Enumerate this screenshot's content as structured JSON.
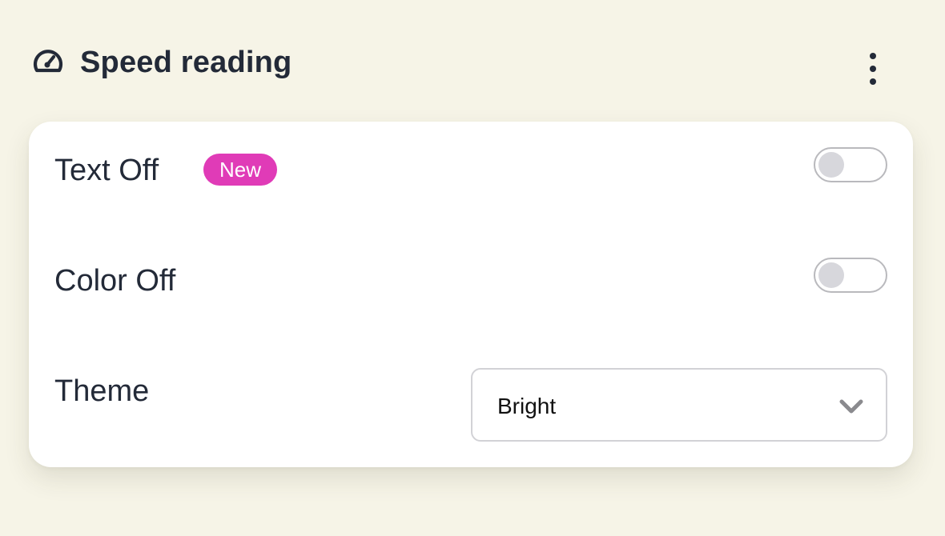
{
  "header": {
    "title": "Speed reading",
    "icon": "speedometer-icon",
    "more_icon": "more-vertical-icon"
  },
  "settings": {
    "text_off": {
      "label": "Text Off",
      "badge": "New",
      "badge_color": "#e03bb7",
      "enabled": false
    },
    "color_off": {
      "label": "Color Off",
      "enabled": false
    },
    "theme": {
      "label": "Theme",
      "selected": "Bright",
      "icon": "chevron-down-icon"
    }
  },
  "colors": {
    "background": "#f6f4e7",
    "card": "#ffffff",
    "text": "#232a38"
  }
}
